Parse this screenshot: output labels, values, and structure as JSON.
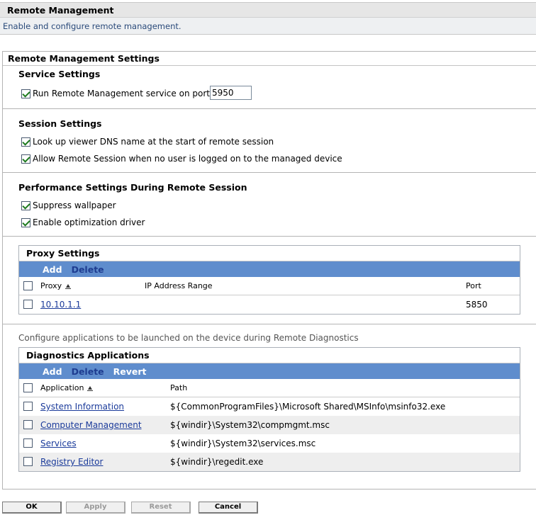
{
  "header": {
    "title": "Remote Management",
    "description": "Enable and configure remote management."
  },
  "settings": {
    "title": "Remote Management Settings",
    "service": {
      "title": "Service Settings",
      "run_service_label": "Run Remote Management service on port",
      "run_service_checked": true,
      "port_value": "5950"
    },
    "session": {
      "title": "Session Settings",
      "lookup_dns_label": "Look up viewer DNS name at the start of remote session",
      "allow_no_user_label": "Allow Remote Session when no user is logged on to the managed device"
    },
    "performance": {
      "title": "Performance Settings During Remote Session",
      "suppress_wallpaper_label": "Suppress wallpaper",
      "optimization_driver_label": "Enable optimization driver"
    }
  },
  "proxy": {
    "title": "Proxy Settings",
    "toolbar": {
      "add": "Add",
      "delete": "Delete"
    },
    "columns": {
      "proxy": "Proxy",
      "ip_range": "IP Address Range",
      "port": "Port"
    },
    "rows": [
      {
        "proxy": "10.10.1.1",
        "ip_range": "",
        "port": "5850"
      }
    ]
  },
  "diagnostics": {
    "note": "Configure applications to be launched on the device during Remote Diagnostics",
    "title": "Diagnostics Applications",
    "toolbar": {
      "add": "Add",
      "delete": "Delete",
      "revert": "Revert"
    },
    "columns": {
      "application": "Application",
      "path": "Path"
    },
    "rows": [
      {
        "application": "System Information",
        "path": "${CommonProgramFiles}\\Microsoft Shared\\MSInfo\\msinfo32.exe"
      },
      {
        "application": "Computer Management",
        "path": "${windir}\\System32\\compmgmt.msc"
      },
      {
        "application": "Services",
        "path": "${windir}\\System32\\services.msc"
      },
      {
        "application": "Registry Editor",
        "path": "${windir}\\regedit.exe"
      }
    ]
  },
  "buttons": {
    "ok": "OK",
    "apply": "Apply",
    "reset": "Reset",
    "cancel": "Cancel"
  },
  "colors": {
    "toolbar": "#5f8dcd",
    "link": "#1a3a9a",
    "check": "#1d7a1d"
  }
}
